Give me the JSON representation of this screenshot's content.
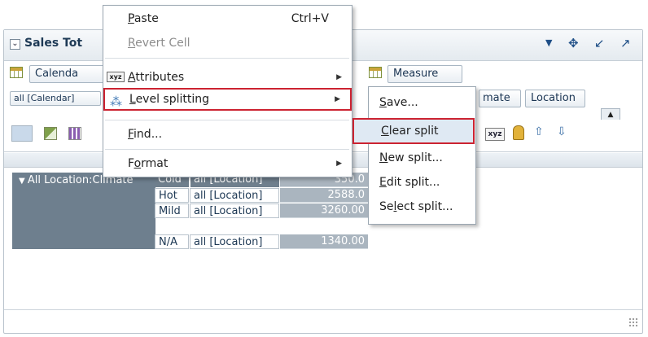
{
  "panel": {
    "title": "Sales Tot",
    "header_tools": [
      "▼",
      "✥",
      "↙",
      "↗"
    ]
  },
  "layout_bar": {
    "calendar_chip": "Calenda",
    "calendar_filter": "all [Calendar]",
    "measure_chip": "Measure",
    "climate_chip": "mate",
    "location_chip": "Location"
  },
  "pivot": {
    "row_header": "All Location:Climate",
    "rows": [
      {
        "climate": "Cold",
        "location": "all [Location]",
        "value": "350.0"
      },
      {
        "climate": "Hot",
        "location": "all [Location]",
        "value": "2588.0"
      },
      {
        "climate": "Mild",
        "location": "all [Location]",
        "value": "3260.00"
      },
      {
        "climate": "N/A",
        "location": "all [Location]",
        "value": "1340.00"
      }
    ]
  },
  "context_menu": {
    "paste": {
      "pre": "",
      "u": "P",
      "post": "aste",
      "shortcut": "Ctrl+V"
    },
    "revert_cell": {
      "pre": "",
      "u": "R",
      "post": "evert Cell"
    },
    "attributes": {
      "pre": "",
      "u": "A",
      "post": "ttributes"
    },
    "level_splitting": {
      "pre": "",
      "u": "L",
      "post": "evel splitting"
    },
    "find": {
      "pre": "",
      "u": "F",
      "post": "ind..."
    },
    "format": {
      "pre": "F",
      "u": "o",
      "post": "rmat"
    }
  },
  "submenu": {
    "save": {
      "u": "S",
      "post": "ave..."
    },
    "clear_split": {
      "u": "C",
      "post": "lear split"
    },
    "new_split": {
      "u": "N",
      "post": "ew split..."
    },
    "edit_split": {
      "u": "E",
      "post": "dit split..."
    },
    "select_split": {
      "pre": "Se",
      "u": "l",
      "post": "ect split..."
    }
  },
  "icons": {
    "attributes": "xyz-icon",
    "level": "split-icon"
  },
  "colors": {
    "highlight_border": "#cc2331",
    "header_text": "#1e3a56",
    "row_header_bg": "#6e7f8e"
  }
}
